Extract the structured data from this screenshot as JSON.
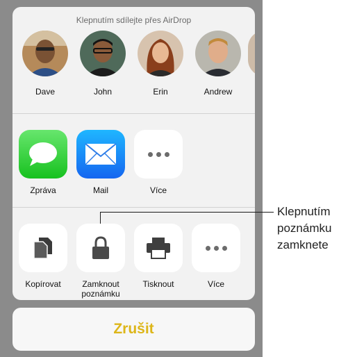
{
  "share_sheet": {
    "airdrop_title": "Klepnutím sdílejte přes AirDrop",
    "people": [
      {
        "name": "Dave",
        "avatar_bg": "#b58a5a"
      },
      {
        "name": "John",
        "avatar_bg": "#4f6a5a"
      },
      {
        "name": "Erin",
        "avatar_bg": "#d7c3ae"
      },
      {
        "name": "Andrew",
        "avatar_bg": "#b9b7ae"
      }
    ],
    "apps": [
      {
        "label": "Zpráva",
        "icon": "messages-icon",
        "color": "#27c82f"
      },
      {
        "label": "Mail",
        "icon": "mail-icon",
        "color": "#1a83f5"
      },
      {
        "label": "Více",
        "icon": "more-icon"
      }
    ],
    "actions": [
      {
        "label": "Kopírovat",
        "icon": "copy-icon"
      },
      {
        "label": "Zamknout\npoznámku",
        "icon": "lock-icon"
      },
      {
        "label": "Tisknout",
        "icon": "printer-icon"
      },
      {
        "label": "Více",
        "icon": "more-icon"
      }
    ]
  },
  "cancel_button": {
    "label": "Zrušit",
    "color": "#ddb619"
  },
  "callout": {
    "text": "Klepnutím\npoznámku\nzamknete"
  }
}
